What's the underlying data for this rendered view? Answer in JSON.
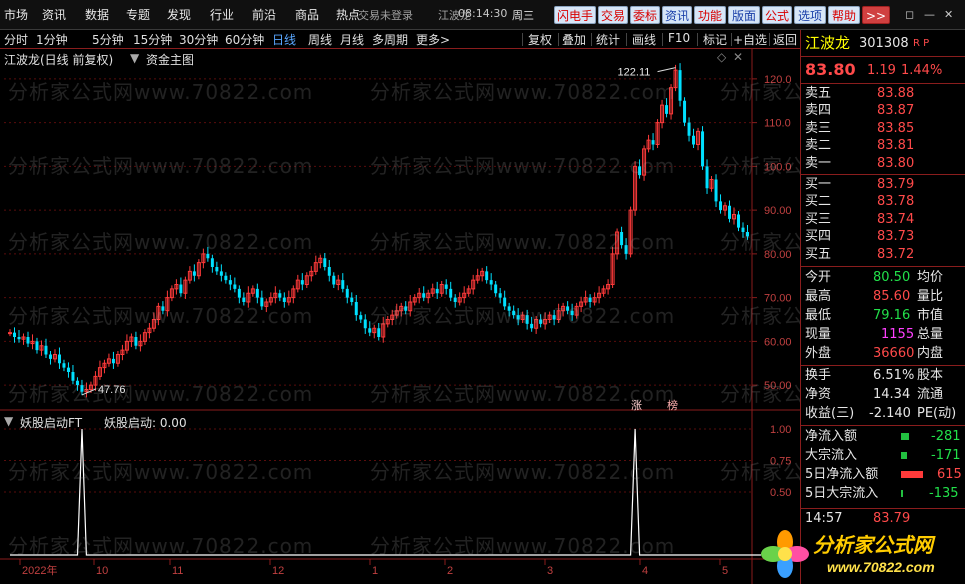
{
  "menubar": {
    "items": [
      "市场",
      "资讯",
      "数据",
      "专题",
      "发现",
      "行业",
      "前沿",
      "商品",
      "热点"
    ],
    "status": "交易未登录",
    "stock_short": "江波龙",
    "time": "08:14:30",
    "weekday": "周三",
    "buttons": [
      "闪电手",
      "交易",
      "委标",
      "资讯",
      "功能",
      "版面",
      "公式",
      "选项",
      "帮助"
    ],
    "more_label": ">>"
  },
  "periodbar": {
    "periods": [
      "分时",
      "1分钟",
      "5分钟",
      "15分钟",
      "30分钟",
      "60分钟",
      "日线",
      "周线",
      "月线",
      "多周期",
      "更多>"
    ],
    "active": "日线",
    "tools": [
      "复权",
      "叠加",
      "统计",
      "画线",
      "F10",
      "标记",
      "+自选",
      "返回"
    ]
  },
  "main_chart": {
    "title": "江波龙(日线 前复权)",
    "indicator": "资金主图",
    "high_label": "122.11",
    "low_label": "47.76",
    "markers": [
      "涨",
      "榜"
    ],
    "y_ticks": [
      "120.0",
      "110.0",
      "100.0",
      "90.00",
      "80.00",
      "70.00",
      "60.00",
      "50.00"
    ]
  },
  "sub_chart": {
    "title": "妖股启动FT",
    "value_label": "妖股启动: 0.00",
    "y_ticks": [
      "1.00",
      "0.75",
      "0.50"
    ]
  },
  "x_axis": {
    "labels": [
      "2022年",
      "10",
      "11",
      "12",
      "1",
      "2",
      "3",
      "4",
      "5"
    ]
  },
  "watermark": {
    "text": "分析家公式网www.70822.com"
  },
  "quote": {
    "name": "江波龙",
    "code": "301308",
    "flags": "R P",
    "price": "83.80",
    "change": "1.19",
    "change_pct": "1.44%",
    "asks": [
      {
        "label": "卖五",
        "price": "83.88"
      },
      {
        "label": "卖四",
        "price": "83.87"
      },
      {
        "label": "卖三",
        "price": "83.85"
      },
      {
        "label": "卖二",
        "price": "83.81"
      },
      {
        "label": "卖一",
        "price": "83.80"
      }
    ],
    "bids": [
      {
        "label": "买一",
        "price": "83.79"
      },
      {
        "label": "买二",
        "price": "83.78"
      },
      {
        "label": "买三",
        "price": "83.74"
      },
      {
        "label": "买四",
        "price": "83.73"
      },
      {
        "label": "买五",
        "price": "83.72"
      }
    ],
    "stats": [
      {
        "label": "今开",
        "value": "80.50",
        "label2": "均价"
      },
      {
        "label": "最高",
        "value": "85.60",
        "label2": "量比"
      },
      {
        "label": "最低",
        "value": "79.16",
        "label2": "市值"
      },
      {
        "label": "现量",
        "value": "1155",
        "label2": "总量"
      },
      {
        "label": "外盘",
        "value": "36660",
        "label2": "内盘"
      }
    ],
    "stats2": [
      {
        "label": "换手",
        "value": "6.51%",
        "label2": "股本"
      },
      {
        "label": "净资",
        "value": "14.34",
        "label2": "流通"
      },
      {
        "label": "收益(三)",
        "value": "-2.140",
        "label2": "PE(动)"
      }
    ],
    "flows": [
      {
        "label": "净流入额",
        "value": "-281"
      },
      {
        "label": "大宗流入",
        "value": "-171"
      },
      {
        "label": "5日净流入额",
        "value": "615"
      },
      {
        "label": "5日大宗流入",
        "value": "-135"
      }
    ],
    "tick": {
      "time": "14:57",
      "price": "83.79"
    }
  },
  "logo": {
    "title": "分析家公式网",
    "url": "www.70822.com"
  },
  "chart_data": {
    "type": "candlestick",
    "title": "江波龙(日线 前复权)",
    "ylim": [
      45,
      125
    ],
    "y_ticks": [
      50,
      60,
      70,
      80,
      90,
      100,
      110,
      120
    ],
    "x_ticks": [
      "2022年",
      "10",
      "11",
      "12",
      "1",
      "2",
      "3",
      "4",
      "5"
    ],
    "annotations": [
      {
        "text": "122.11",
        "value": 122.11
      },
      {
        "text": "47.76",
        "value": 47.76
      }
    ],
    "series": [
      {
        "name": "close",
        "values": [
          62,
          61,
          60.5,
          61,
          59.5,
          60,
          58,
          59,
          57,
          56,
          57,
          55,
          54,
          53,
          51,
          50,
          48.5,
          49,
          50,
          52,
          54,
          55,
          56,
          55,
          57,
          58,
          60,
          61,
          59,
          60,
          62,
          63,
          65,
          68,
          67,
          70,
          72,
          73,
          71,
          74,
          76,
          75,
          78,
          80,
          79,
          77,
          76,
          75,
          74,
          73,
          72,
          70,
          69,
          71,
          72,
          70,
          68,
          69,
          70,
          71,
          70,
          69,
          70,
          72,
          74,
          73,
          75,
          76,
          78,
          79,
          77,
          75,
          73,
          74,
          72,
          70,
          69,
          66,
          65,
          63,
          62,
          63,
          61,
          64,
          65,
          66,
          67,
          68,
          67,
          69,
          70,
          71,
          70,
          71,
          72,
          71,
          73,
          72,
          70,
          69,
          70,
          71,
          72,
          74,
          75,
          76,
          74,
          73,
          71,
          70,
          68,
          67,
          66,
          65,
          66,
          64,
          63,
          65,
          64,
          65,
          66,
          65,
          67,
          68,
          67,
          66,
          68,
          69,
          70,
          69,
          70,
          71,
          72,
          73,
          80,
          85,
          82,
          80,
          90,
          100,
          98,
          104,
          106,
          105,
          110,
          114,
          112,
          118,
          122,
          115,
          110,
          107,
          105,
          108,
          100,
          95,
          97,
          92,
          90,
          91,
          88,
          89,
          86,
          85,
          84
        ]
      },
      {
        "name": "妖股启动",
        "values": [
          0,
          0,
          0,
          0,
          0,
          0,
          0,
          0,
          0,
          0,
          0,
          0,
          0,
          0,
          0,
          0,
          1,
          0,
          0,
          0,
          0,
          0,
          0,
          0,
          0,
          0,
          0,
          0,
          0,
          0,
          0,
          0,
          0,
          0,
          0,
          0,
          0,
          0,
          0,
          0,
          0,
          0,
          0,
          0,
          0,
          0,
          0,
          0,
          0,
          0,
          0,
          0,
          0,
          0,
          0,
          0,
          0,
          0,
          0,
          0,
          0,
          0,
          0,
          0,
          0,
          0,
          0,
          0,
          0,
          0,
          0,
          0,
          0,
          0,
          0,
          0,
          0,
          0,
          0,
          0,
          0,
          0,
          0,
          0,
          0,
          0,
          0,
          0,
          0,
          0,
          0,
          0,
          0,
          0,
          0,
          0,
          0,
          0,
          0,
          0,
          0,
          0,
          0,
          0,
          0,
          0,
          0,
          0,
          0,
          0,
          0,
          0,
          0,
          0,
          0,
          0,
          0,
          0,
          0,
          0,
          0,
          0,
          0,
          0,
          0,
          0,
          0,
          0,
          0,
          0,
          0,
          0,
          0,
          0,
          0,
          0,
          0,
          0,
          0,
          1,
          0,
          0,
          0,
          0,
          0,
          0,
          0,
          0,
          0,
          0,
          0,
          0,
          0,
          0,
          0,
          0,
          0,
          0,
          0,
          0,
          0,
          0,
          0,
          0,
          0,
          0,
          0,
          0
        ]
      }
    ]
  }
}
